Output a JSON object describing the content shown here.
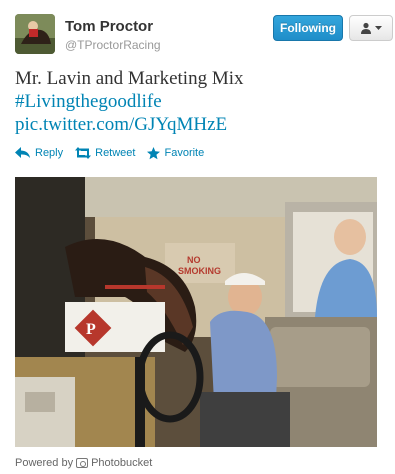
{
  "header": {
    "display_name": "Tom Proctor",
    "handle": "@TProctorRacing",
    "follow_label": "Following"
  },
  "tweet": {
    "text": "Mr. Lavin and Marketing Mix",
    "hashtag": "#Livingthegoodlife",
    "link": "pic.twitter.com/GJYqMHzE"
  },
  "actions": {
    "reply": "Reply",
    "retweet": "Retweet",
    "favorite": "Favorite"
  },
  "photo": {
    "sign_text": "NO\nSMOKING",
    "saddle_letter": "P"
  },
  "footer": {
    "powered_prefix": "Powered by",
    "provider": "Photobucket"
  },
  "colors": {
    "link": "#0084b4",
    "follow_button": "#2b9ad6"
  },
  "icons": {
    "reply": "reply-arrow-icon",
    "retweet": "retweet-icon",
    "favorite": "star-icon",
    "user_menu": "person-icon",
    "photobucket": "camera-icon"
  }
}
